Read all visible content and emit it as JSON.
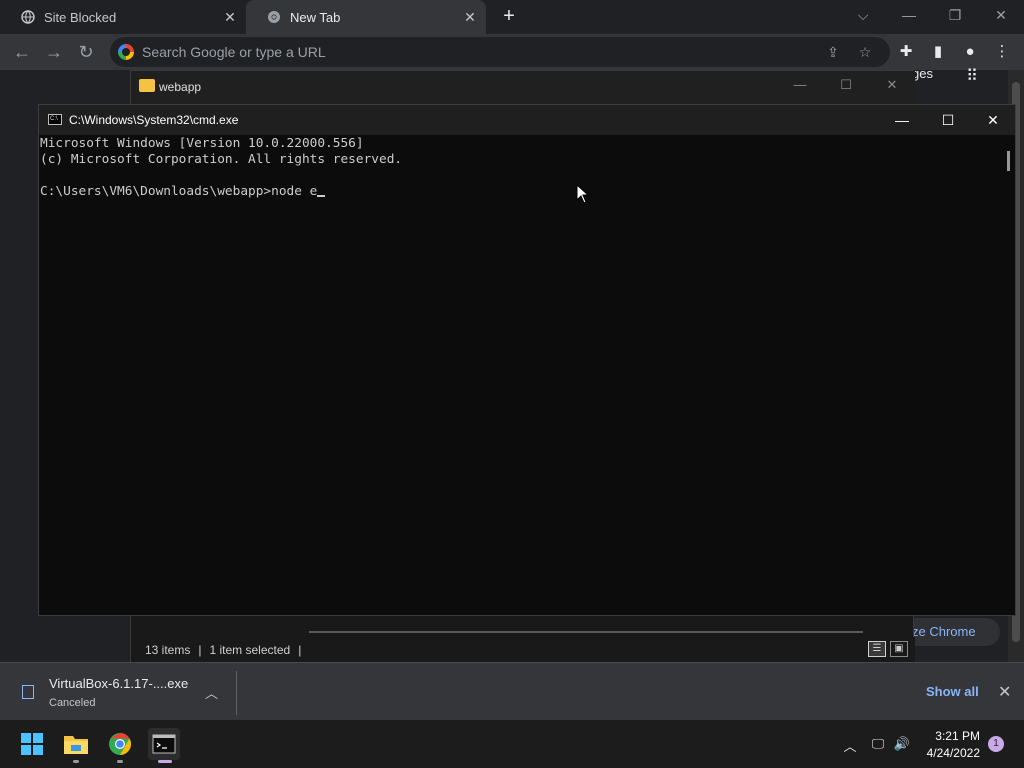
{
  "browser": {
    "tabs": [
      {
        "title": "Site Blocked",
        "icon": "globe-icon"
      },
      {
        "title": "New Tab",
        "icon": "chrome-icon"
      }
    ],
    "omnibox": {
      "placeholder": "Search Google or type a URL"
    },
    "page": {
      "partial_label_top": "ges",
      "customize_button": "ze Chrome"
    }
  },
  "explorer": {
    "title": "webapp",
    "status": {
      "items": "13 items",
      "selected": "1 item selected"
    }
  },
  "cmd": {
    "title": "C:\\Windows\\System32\\cmd.exe",
    "lines": [
      "Microsoft Windows [Version 10.0.22000.556]",
      "(c) Microsoft Corporation. All rights reserved.",
      "",
      "C:\\Users\\VM6\\Downloads\\webapp>node e"
    ]
  },
  "downloads": {
    "file_name": "VirtualBox-6.1.17-....exe",
    "status": "Canceled",
    "show_all": "Show all"
  },
  "taskbar": {
    "time": "3:21 PM",
    "date": "4/24/2022",
    "notification_count": "1"
  },
  "colors": {
    "accent": "#8ab4f8",
    "chrome_bg": "#202124",
    "cmd_bg": "#0c0c0c"
  }
}
